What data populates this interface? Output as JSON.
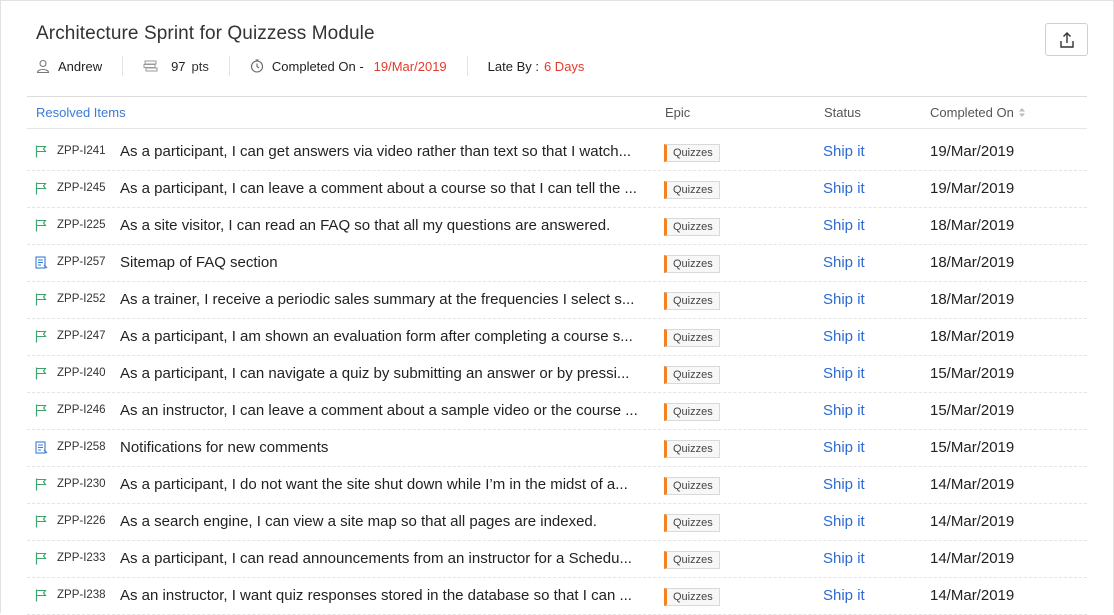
{
  "header": {
    "title": "Architecture Sprint for Quizzess Module",
    "owner": "Andrew",
    "points": "97",
    "points_unit": "pts",
    "completed_label": "Completed On -",
    "completed_date": "19/Mar/2019",
    "late_label": "Late By :",
    "late_value": "6 Days",
    "export_icon": "export-icon"
  },
  "table": {
    "headers": {
      "resolved": "Resolved Items",
      "epic": "Epic",
      "status": "Status",
      "completed": "Completed On"
    },
    "rows": [
      {
        "type": "story",
        "id": "ZPP-I241",
        "summary": "As a participant, I can get answers via video rather than text so that I watch...",
        "epic": "Quizzes",
        "status": "Ship it",
        "date": "19/Mar/2019"
      },
      {
        "type": "story",
        "id": "ZPP-I245",
        "summary": "As a participant, I can leave a comment about a course so that I can tell the ...",
        "epic": "Quizzes",
        "status": "Ship it",
        "date": "19/Mar/2019"
      },
      {
        "type": "story",
        "id": "ZPP-I225",
        "summary": "As a site visitor, I can read an FAQ so that all my questions are answered.",
        "epic": "Quizzes",
        "status": "Ship it",
        "date": "18/Mar/2019"
      },
      {
        "type": "task",
        "id": "ZPP-I257",
        "summary": "Sitemap of FAQ section",
        "epic": "Quizzes",
        "status": "Ship it",
        "date": "18/Mar/2019"
      },
      {
        "type": "story",
        "id": "ZPP-I252",
        "summary": "As a trainer, I receive a periodic sales summary at the frequencies I select s...",
        "epic": "Quizzes",
        "status": "Ship it",
        "date": "18/Mar/2019"
      },
      {
        "type": "story",
        "id": "ZPP-I247",
        "summary": "As a participant, I am shown an evaluation form after completing a course s...",
        "epic": "Quizzes",
        "status": "Ship it",
        "date": "18/Mar/2019"
      },
      {
        "type": "story",
        "id": "ZPP-I240",
        "summary": "As a participant, I can navigate a quiz by submitting an answer or by pressi...",
        "epic": "Quizzes",
        "status": "Ship it",
        "date": "15/Mar/2019"
      },
      {
        "type": "story",
        "id": "ZPP-I246",
        "summary": "As an instructor, I can leave a comment about a sample video or the course ...",
        "epic": "Quizzes",
        "status": "Ship it",
        "date": "15/Mar/2019"
      },
      {
        "type": "task",
        "id": "ZPP-I258",
        "summary": "Notifications for new comments",
        "epic": "Quizzes",
        "status": "Ship it",
        "date": "15/Mar/2019"
      },
      {
        "type": "story",
        "id": "ZPP-I230",
        "summary": "As a participant, I do not want the site shut down while I’m in the midst of a...",
        "epic": "Quizzes",
        "status": "Ship it",
        "date": "14/Mar/2019"
      },
      {
        "type": "story",
        "id": "ZPP-I226",
        "summary": "As a search engine, I can view a site map so that all pages are indexed.",
        "epic": "Quizzes",
        "status": "Ship it",
        "date": "14/Mar/2019"
      },
      {
        "type": "story",
        "id": "ZPP-I233",
        "summary": "As a participant, I can read announcements from an instructor for a Schedu...",
        "epic": "Quizzes",
        "status": "Ship it",
        "date": "14/Mar/2019"
      },
      {
        "type": "story",
        "id": "ZPP-I238",
        "summary": "As an instructor, I want quiz responses stored in the database so that I can ...",
        "epic": "Quizzes",
        "status": "Ship it",
        "date": "14/Mar/2019"
      }
    ]
  },
  "colors": {
    "accent_link": "#2d6ad1",
    "late_red": "#e33a2e",
    "epic_bar": "#f58220",
    "story_icon": "#3aa66b",
    "task_icon": "#3a7bd5"
  }
}
